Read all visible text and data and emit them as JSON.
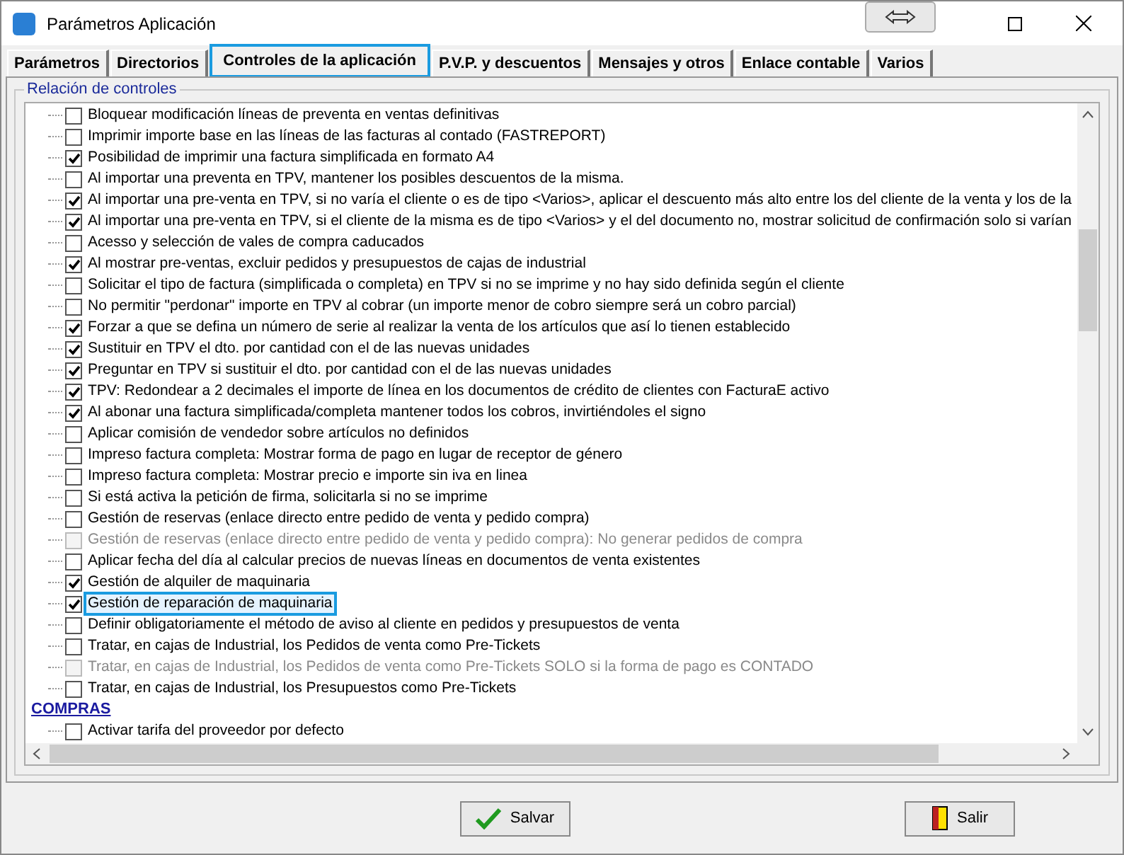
{
  "window": {
    "title": "Parámetros Aplicación"
  },
  "tabs": [
    {
      "label": "Parámetros",
      "selected": false
    },
    {
      "label": "Directorios",
      "selected": false
    },
    {
      "label": "Controles de la aplicación",
      "selected": true
    },
    {
      "label": "P.V.P. y descuentos",
      "selected": false
    },
    {
      "label": "Mensajes y otros",
      "selected": false
    },
    {
      "label": "Enlace contable",
      "selected": false
    },
    {
      "label": "Varios",
      "selected": false
    }
  ],
  "group": {
    "title": "Relación de controles"
  },
  "items": [
    {
      "kind": "option",
      "label": "Bloquear modificación líneas de preventa en ventas definitivas",
      "checked": false,
      "disabled": false,
      "selected": false
    },
    {
      "kind": "option",
      "label": "Imprimir importe base en las líneas de las facturas al contado (FASTREPORT)",
      "checked": false,
      "disabled": false,
      "selected": false
    },
    {
      "kind": "option",
      "label": "Posibilidad de imprimir una factura simplificada en formato A4",
      "checked": true,
      "disabled": false,
      "selected": false
    },
    {
      "kind": "option",
      "label": "Al importar una preventa en TPV, mantener los posibles descuentos de la misma.",
      "checked": false,
      "disabled": false,
      "selected": false
    },
    {
      "kind": "option",
      "label": "Al importar una pre-venta en TPV, si no varía el cliente o es de tipo <Varios>, aplicar el descuento más alto entre los del cliente de la venta y los de la",
      "checked": true,
      "disabled": false,
      "selected": false
    },
    {
      "kind": "option",
      "label": "Al importar una pre-venta en TPV, si el cliente de la misma es de tipo <Varios> y el del documento no, mostrar solicitud de confirmación solo si varían",
      "checked": true,
      "disabled": false,
      "selected": false
    },
    {
      "kind": "option",
      "label": "Acesso y selección de vales de compra caducados",
      "checked": false,
      "disabled": false,
      "selected": false
    },
    {
      "kind": "option",
      "label": "Al mostrar pre-ventas, excluir pedidos y presupuestos de cajas de industrial",
      "checked": true,
      "disabled": false,
      "selected": false
    },
    {
      "kind": "option",
      "label": "Solicitar el tipo de factura (simplificada o completa) en TPV si no se imprime y no hay sido definida según el cliente",
      "checked": false,
      "disabled": false,
      "selected": false
    },
    {
      "kind": "option",
      "label": "No permitir \"perdonar\" importe en TPV al cobrar (un importe menor de cobro siempre será un cobro parcial)",
      "checked": false,
      "disabled": false,
      "selected": false
    },
    {
      "kind": "option",
      "label": "Forzar a que se defina un número de serie al realizar la venta de los artículos que así lo tienen establecido",
      "checked": true,
      "disabled": false,
      "selected": false
    },
    {
      "kind": "option",
      "label": "Sustituir en TPV el dto. por cantidad con el de las nuevas unidades",
      "checked": true,
      "disabled": false,
      "selected": false
    },
    {
      "kind": "option",
      "label": "Preguntar en TPV si sustituir el dto. por cantidad con el de las nuevas unidades",
      "checked": true,
      "disabled": false,
      "selected": false
    },
    {
      "kind": "option",
      "label": "TPV: Redondear a 2 decimales el importe de línea en los documentos de crédito de clientes con FacturaE activo",
      "checked": true,
      "disabled": false,
      "selected": false
    },
    {
      "kind": "option",
      "label": "Al abonar una factura simplificada/completa mantener todos los cobros, invirtiéndoles el signo",
      "checked": true,
      "disabled": false,
      "selected": false
    },
    {
      "kind": "option",
      "label": "Aplicar comisión de vendedor sobre artículos no definidos",
      "checked": false,
      "disabled": false,
      "selected": false
    },
    {
      "kind": "option",
      "label": "Impreso factura completa: Mostrar forma de pago en lugar de receptor de género",
      "checked": false,
      "disabled": false,
      "selected": false
    },
    {
      "kind": "option",
      "label": "Impreso factura completa: Mostrar precio e importe sin iva en linea",
      "checked": false,
      "disabled": false,
      "selected": false
    },
    {
      "kind": "option",
      "label": "Si está activa la petición de firma, solicitarla si no se imprime",
      "checked": false,
      "disabled": false,
      "selected": false
    },
    {
      "kind": "option",
      "label": "Gestión de reservas (enlace directo entre pedido de venta y pedido compra)",
      "checked": false,
      "disabled": false,
      "selected": false
    },
    {
      "kind": "option",
      "label": "Gestión de reservas (enlace directo entre pedido de venta y pedido compra): No generar pedidos de compra",
      "checked": false,
      "disabled": true,
      "selected": false
    },
    {
      "kind": "option",
      "label": "Aplicar fecha del día al calcular precios de nuevas líneas en documentos de venta existentes",
      "checked": false,
      "disabled": false,
      "selected": false
    },
    {
      "kind": "option",
      "label": "Gestión de alquiler de maquinaria",
      "checked": true,
      "disabled": false,
      "selected": false
    },
    {
      "kind": "option",
      "label": "Gestión de reparación de maquinaria",
      "checked": true,
      "disabled": false,
      "selected": true
    },
    {
      "kind": "option",
      "label": "Definir obligatoriamente el método de aviso al cliente en pedidos y presupuestos de venta",
      "checked": false,
      "disabled": false,
      "selected": false
    },
    {
      "kind": "option",
      "label": "Tratar, en cajas de Industrial, los Pedidos de venta como Pre-Tickets",
      "checked": false,
      "disabled": false,
      "selected": false
    },
    {
      "kind": "option",
      "label": "Tratar, en cajas de Industrial, los Pedidos de venta como Pre-Tickets SOLO si la forma de pago es CONTADO",
      "checked": false,
      "disabled": true,
      "selected": false
    },
    {
      "kind": "option",
      "label": "Tratar, en cajas de Industrial, los Presupuestos como Pre-Tickets",
      "checked": false,
      "disabled": false,
      "selected": false
    },
    {
      "kind": "section",
      "label": "COMPRAS"
    },
    {
      "kind": "option",
      "label": "Activar tarifa del proveedor por defecto",
      "checked": false,
      "disabled": false,
      "selected": false
    }
  ],
  "buttons": [
    {
      "kind": "save",
      "label": "Salvar"
    },
    {
      "kind": "exit",
      "label": "Salir"
    }
  ]
}
